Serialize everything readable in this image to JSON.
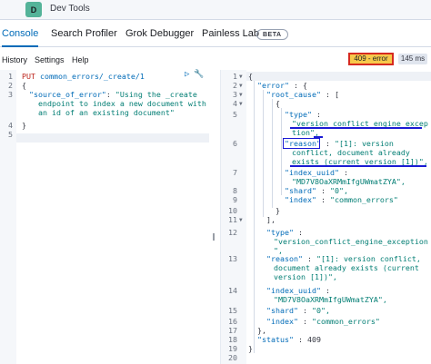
{
  "app": {
    "avatar_letter": "D",
    "title": "Dev Tools"
  },
  "tabs": [
    {
      "label": "Console",
      "active": true
    },
    {
      "label": "Search Profiler"
    },
    {
      "label": "Grok Debugger"
    },
    {
      "label": "Painless Lab"
    }
  ],
  "beta_label": "BETA",
  "subbar": {
    "history": "History",
    "settings": "Settings",
    "help": "Help"
  },
  "response_status": {
    "status": "409 - error",
    "time": "145 ms"
  },
  "request": {
    "line_numbers": [
      "1",
      "2",
      "3",
      "4",
      "5"
    ],
    "method": "PUT",
    "path": "common_errors/_create/1",
    "line2": "{",
    "line3_key": "\"source_of_error\"",
    "line3_val_a": "\"Using the _create",
    "line3_val_b": "endpoint to index a new document with",
    "line3_val_c": "an id of an existing document\"",
    "line4": "}"
  },
  "response": {
    "line_numbers": [
      "1",
      "2",
      "3",
      "4",
      "5",
      "",
      "6",
      "",
      "",
      "7",
      "",
      "8",
      "9",
      "10",
      "11",
      "12",
      "",
      "13",
      "",
      "",
      "14",
      "",
      "15",
      "16",
      "17",
      "18",
      "19",
      "20"
    ],
    "l1": "{",
    "l2_key": "\"error\"",
    "l2_rest": " : {",
    "l3_key": "\"root_cause\"",
    "l3_rest": " : [",
    "l4": "{",
    "l5_key": "\"type\"",
    "l5_val_a": "\"version_conflict_engine_excep",
    "l5_val_b": "tion\",",
    "l6_key": "\"reason\"",
    "l6_val_a": "\"[1]: version",
    "l6_val_b": "conflict, document already",
    "l6_val_c": "exists (current version [1])\",",
    "l7_key": "\"index_uuid\"",
    "l7_val": "\"MD7V8OaXRMmIfgUWmatZYA\",",
    "l8_key": "\"shard\"",
    "l8_val": "\"0\",",
    "l9_key": "\"index\"",
    "l9_val": "\"common_errors\"",
    "l10": "}",
    "l11": "],",
    "l12_key": "\"type\"",
    "l12_val": "\"version_conflict_engine_exception",
    "l12_val_b": "\",",
    "l13_key": "\"reason\"",
    "l13_val_a": "\"[1]: version conflict,",
    "l13_val_b": "document already exists (current",
    "l13_val_c": "version [1])\",",
    "l14_key": "\"index_uuid\"",
    "l14_val": "\"MD7V8OaXRMmIfgUWmatZYA\",",
    "l15_key": "\"shard\"",
    "l15_val": "\"0\",",
    "l16_key": "\"index\"",
    "l16_val": "\"common_errors\"",
    "l17": "},",
    "l18_key": "\"status\"",
    "l18_val": "409",
    "l19": "}"
  },
  "icons": {
    "run": "play-icon",
    "settings": "wrench-icon",
    "resize": "drag-handle-icon"
  }
}
